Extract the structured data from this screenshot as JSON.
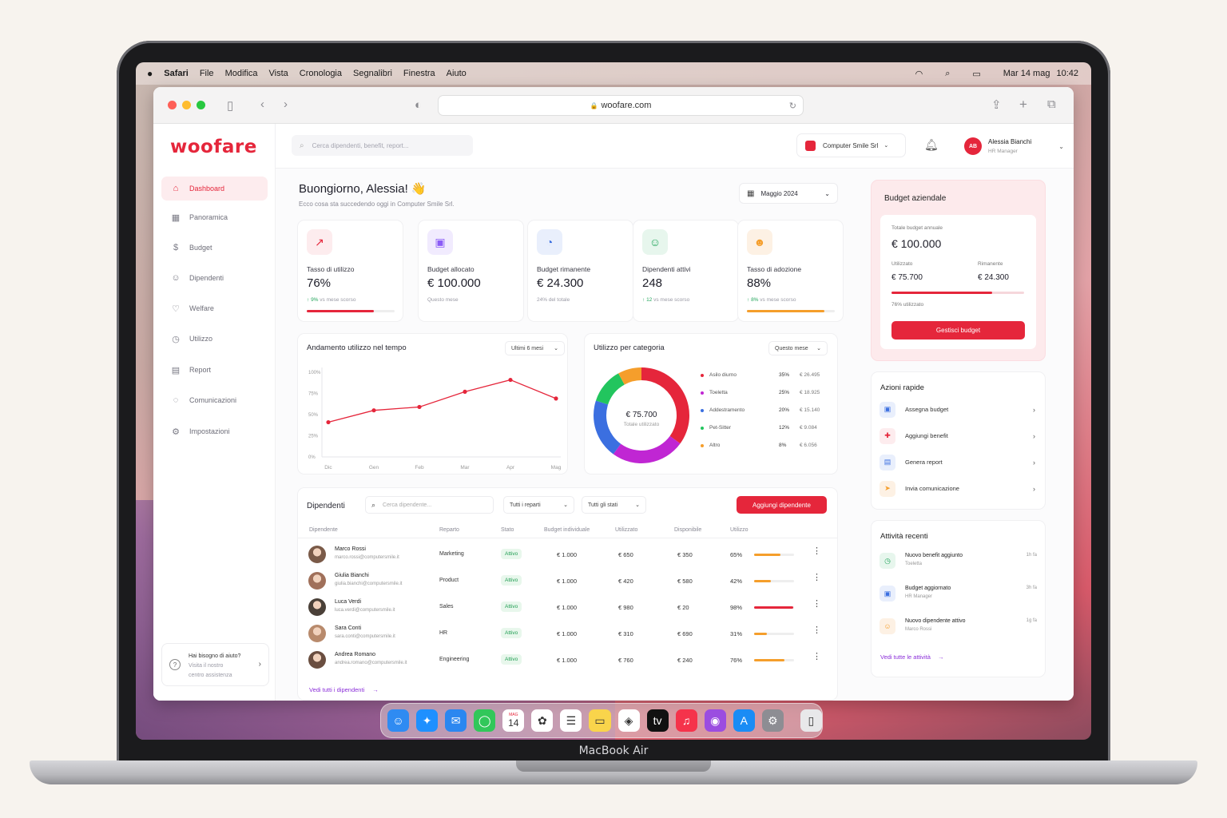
{
  "macos": {
    "app_name": "Safari",
    "menus": [
      "File",
      "Modifica",
      "Vista",
      "Cronologia",
      "Segnalibri",
      "Finestra",
      "Aiuto"
    ],
    "clock_date": "Mar 14 mag",
    "clock_time": "10:42",
    "device_label": "MacBook Air"
  },
  "browser": {
    "url": "woofare.com"
  },
  "brand": {
    "logo": "woofare",
    "accent": "#e5263b"
  },
  "sidebar": {
    "items": [
      {
        "label": "Dashboard",
        "icon": "home-icon",
        "glyph": "⌂"
      },
      {
        "label": "Panoramica",
        "icon": "grid-icon",
        "glyph": "▦"
      },
      {
        "label": "Budget",
        "icon": "coin-icon",
        "glyph": "$"
      },
      {
        "label": "Dipendenti",
        "icon": "users-icon",
        "glyph": "☺"
      },
      {
        "label": "Welfare",
        "icon": "heart-icon",
        "glyph": "♡"
      },
      {
        "label": "Utilizzo",
        "icon": "clock-icon",
        "glyph": "◷"
      },
      {
        "label": "Report",
        "icon": "document-icon",
        "glyph": "▤"
      },
      {
        "label": "Comunicazioni",
        "icon": "chat-icon",
        "glyph": "◌"
      },
      {
        "label": "Impostazioni",
        "icon": "gear-icon",
        "glyph": "⚙"
      }
    ],
    "help": {
      "title": "Hai bisogno di aiuto?",
      "line1": "Visita il nostro",
      "line2": "centro assistenza"
    }
  },
  "topbar": {
    "search_placeholder": "Cerca dipendenti, benefit, report...",
    "company": "Computer Smile Srl",
    "user_initials": "AB",
    "user_name": "Alessia Bianchi",
    "user_role": "HR Manager"
  },
  "header": {
    "greeting": "Buongiorno, Alessia! 👋",
    "subtitle": "Ecco cosa sta succedendo oggi in Computer Smile Srl.",
    "period": "Maggio 2024"
  },
  "kpis": [
    {
      "label": "Tasso di utilizzo",
      "value": "76%",
      "delta": "9%",
      "sub": "vs mese scorso",
      "progress": 0.76,
      "color": "#e5263b",
      "bg": "#fdecee",
      "icon": "trend-icon",
      "glyph": "↗"
    },
    {
      "label": "Budget allocato",
      "value": "€ 100.000",
      "delta": "",
      "sub": "Questo mese",
      "progress": null,
      "color": "#8b5cf6",
      "bg": "#f1ebfe",
      "icon": "wallet-icon",
      "glyph": "▣"
    },
    {
      "label": "Budget rimanente",
      "value": "€ 24.300",
      "delta": "",
      "sub": "24% del totale",
      "progress": null,
      "color": "#3b6fe0",
      "bg": "#e9effc",
      "icon": "pie-icon",
      "glyph": "◔"
    },
    {
      "label": "Dipendenti attivi",
      "value": "248",
      "delta": "12",
      "sub": "vs mese scorso",
      "progress": null,
      "color": "#22a55b",
      "bg": "#e7f6ed",
      "icon": "user-icon",
      "glyph": "☺"
    },
    {
      "label": "Tasso di adozione",
      "value": "88%",
      "delta": "8%",
      "sub": "vs mese scorso",
      "progress": 0.88,
      "color": "#f59e2b",
      "bg": "#fdf1e4",
      "icon": "group-icon",
      "glyph": "☻"
    }
  ],
  "line_card": {
    "title": "Andamento utilizzo nel tempo",
    "range": "Ultimi 6 mesi"
  },
  "chart_data": [
    {
      "type": "line",
      "title": "Andamento utilizzo nel tempo",
      "categories": [
        "Dic",
        "Gen",
        "Feb",
        "Mar",
        "Apr",
        "Mag"
      ],
      "y_ticks": [
        "100%",
        "75%",
        "50%",
        "25%",
        "0%"
      ],
      "ylim": [
        0,
        100
      ],
      "series": [
        {
          "values": [
            41,
            55,
            59,
            77,
            91,
            69
          ],
          "color": "#e5263b"
        }
      ],
      "grid": false
    },
    {
      "type": "pie",
      "title": "Utilizzo per categoria",
      "center_value": "€ 75.700",
      "center_label": "Totale utilizzato",
      "slices": [
        {
          "label": "Asilo diurno",
          "pct": 35,
          "pct_label": "35%",
          "amount": "€ 26.495",
          "color": "#e5263b"
        },
        {
          "label": "Toeletta",
          "pct": 25,
          "pct_label": "25%",
          "amount": "€ 18.925",
          "color": "#c026d3"
        },
        {
          "label": "Addestramento",
          "pct": 20,
          "pct_label": "20%",
          "amount": "€ 15.140",
          "color": "#3b6fe0"
        },
        {
          "label": "Pet-Sitter",
          "pct": 12,
          "pct_label": "12%",
          "amount": "€ 9.084",
          "color": "#22c55e"
        },
        {
          "label": "Altro",
          "pct": 8,
          "pct_label": "8%",
          "amount": "€ 6.056",
          "color": "#f59e2b"
        }
      ]
    }
  ],
  "category_card": {
    "title": "Utilizzo per categoria",
    "range": "Questo mese"
  },
  "employees": {
    "title": "Dipendenti",
    "search_placeholder": "Cerca dipendente...",
    "filter_dept": "Tutti i reparti",
    "filter_status": "Tutti gli stati",
    "add_label": "Aggiungi dipendente",
    "columns": [
      "Dipendente",
      "Reparto",
      "Stato",
      "Budget individuale",
      "Utilizzato",
      "Disponibile",
      "Utilizzo"
    ],
    "rows": [
      {
        "name": "Marco Rossi",
        "email": "marco.rossi@computersmile.it",
        "dept": "Marketing",
        "status": "Attivo",
        "budget": "€ 1.000",
        "used": "€ 650",
        "avail": "€ 350",
        "pct": "65%",
        "ratio": 0.65,
        "bar": "#f59e2b",
        "face": "#7a5a48"
      },
      {
        "name": "Giulia Bianchi",
        "email": "giulia.bianchi@computersmile.it",
        "dept": "Product",
        "status": "Attivo",
        "budget": "€ 1.000",
        "used": "€ 420",
        "avail": "€ 580",
        "pct": "42%",
        "ratio": 0.42,
        "bar": "#f59e2b",
        "face": "#a0705a"
      },
      {
        "name": "Luca Verdi",
        "email": "luca.verdi@computersmile.it",
        "dept": "Sales",
        "status": "Attivo",
        "budget": "€ 1.000",
        "used": "€ 980",
        "avail": "€ 20",
        "pct": "98%",
        "ratio": 0.98,
        "bar": "#e5263b",
        "face": "#4a4038"
      },
      {
        "name": "Sara Conti",
        "email": "sara.conti@computersmile.it",
        "dept": "HR",
        "status": "Attivo",
        "budget": "€ 1.000",
        "used": "€ 310",
        "avail": "€ 690",
        "pct": "31%",
        "ratio": 0.31,
        "bar": "#f59e2b",
        "face": "#b88a6c"
      },
      {
        "name": "Andrea Romano",
        "email": "andrea.romano@computersmile.it",
        "dept": "Engineering",
        "status": "Attivo",
        "budget": "€ 1.000",
        "used": "€ 760",
        "avail": "€ 240",
        "pct": "76%",
        "ratio": 0.76,
        "bar": "#f59e2b",
        "face": "#6a4e40"
      }
    ],
    "view_all": "Vedi tutti i dipendenti"
  },
  "budget": {
    "title": "Budget aziendale",
    "annual_label": "Totale budget annuale",
    "annual_value": "€ 100.000",
    "used_label": "Utilizzato",
    "used_value": "€ 75.700",
    "remaining_label": "Rimanente",
    "remaining_value": "€ 24.300",
    "used_ratio": 0.76,
    "used_pct_label": "76% utilizzato",
    "button": "Gestisci budget"
  },
  "quick_actions": {
    "title": "Azioni rapide",
    "items": [
      {
        "label": "Assegna budget",
        "icon": "wallet-icon",
        "glyph": "▣",
        "color": "#3b6fe0",
        "bg": "#e9effc"
      },
      {
        "label": "Aggiungi benefit",
        "icon": "gift-icon",
        "glyph": "✚",
        "color": "#e5263b",
        "bg": "#fdecee"
      },
      {
        "label": "Genera report",
        "icon": "document-icon",
        "glyph": "▤",
        "color": "#3b6fe0",
        "bg": "#e9effc"
      },
      {
        "label": "Invia comunicazione",
        "icon": "send-icon",
        "glyph": "➤",
        "color": "#f59e2b",
        "bg": "#fdf1e4"
      }
    ]
  },
  "activity": {
    "title": "Attività recenti",
    "items": [
      {
        "title": "Nuovo benefit aggiunto",
        "sub": "Toeletta",
        "time": "1h fa",
        "icon": "clock-icon",
        "glyph": "◷",
        "color": "#22a55b",
        "bg": "#e7f6ed"
      },
      {
        "title": "Budget aggiornato",
        "sub": "HR Manager",
        "time": "3h fa",
        "icon": "wallet-icon",
        "glyph": "▣",
        "color": "#3b6fe0",
        "bg": "#e9effc"
      },
      {
        "title": "Nuovo dipendente attivo",
        "sub": "Marco Rossi",
        "time": "1g fa",
        "icon": "user-icon",
        "glyph": "☺",
        "color": "#f59e2b",
        "bg": "#fdf1e4"
      }
    ],
    "view_all": "Vedi tutte le attività"
  },
  "dock": {
    "apps": [
      {
        "name": "finder-icon",
        "glyph": "☺",
        "color": "#2f8bf2"
      },
      {
        "name": "safari-icon",
        "glyph": "✦",
        "color": "#1e90ff"
      },
      {
        "name": "mail-icon",
        "glyph": "✉",
        "color": "#2b87f0"
      },
      {
        "name": "messages-icon",
        "glyph": "◯",
        "color": "#31c75a"
      },
      {
        "name": "calendar-icon",
        "glyph": "14",
        "color": "#ffffff"
      },
      {
        "name": "photos-icon",
        "glyph": "✿",
        "color": "#ffffff"
      },
      {
        "name": "reminders-icon",
        "glyph": "☰",
        "color": "#ffffff"
      },
      {
        "name": "notes-icon",
        "glyph": "▭",
        "color": "#f9d44b"
      },
      {
        "name": "freeform-icon",
        "glyph": "◈",
        "color": "#ffffff"
      },
      {
        "name": "tv-icon",
        "glyph": "tv",
        "color": "#111111"
      },
      {
        "name": "music-icon",
        "glyph": "♫",
        "color": "#f5334b"
      },
      {
        "name": "podcasts-icon",
        "glyph": "◉",
        "color": "#9b4de0"
      },
      {
        "name": "appstore-icon",
        "glyph": "A",
        "color": "#1a8cf5"
      },
      {
        "name": "settings-icon",
        "glyph": "⚙",
        "color": "#8d8d93"
      },
      {
        "name": "trash-icon",
        "glyph": "▯",
        "color": "#e8e8ea"
      }
    ],
    "calendar_month": "MAG"
  }
}
